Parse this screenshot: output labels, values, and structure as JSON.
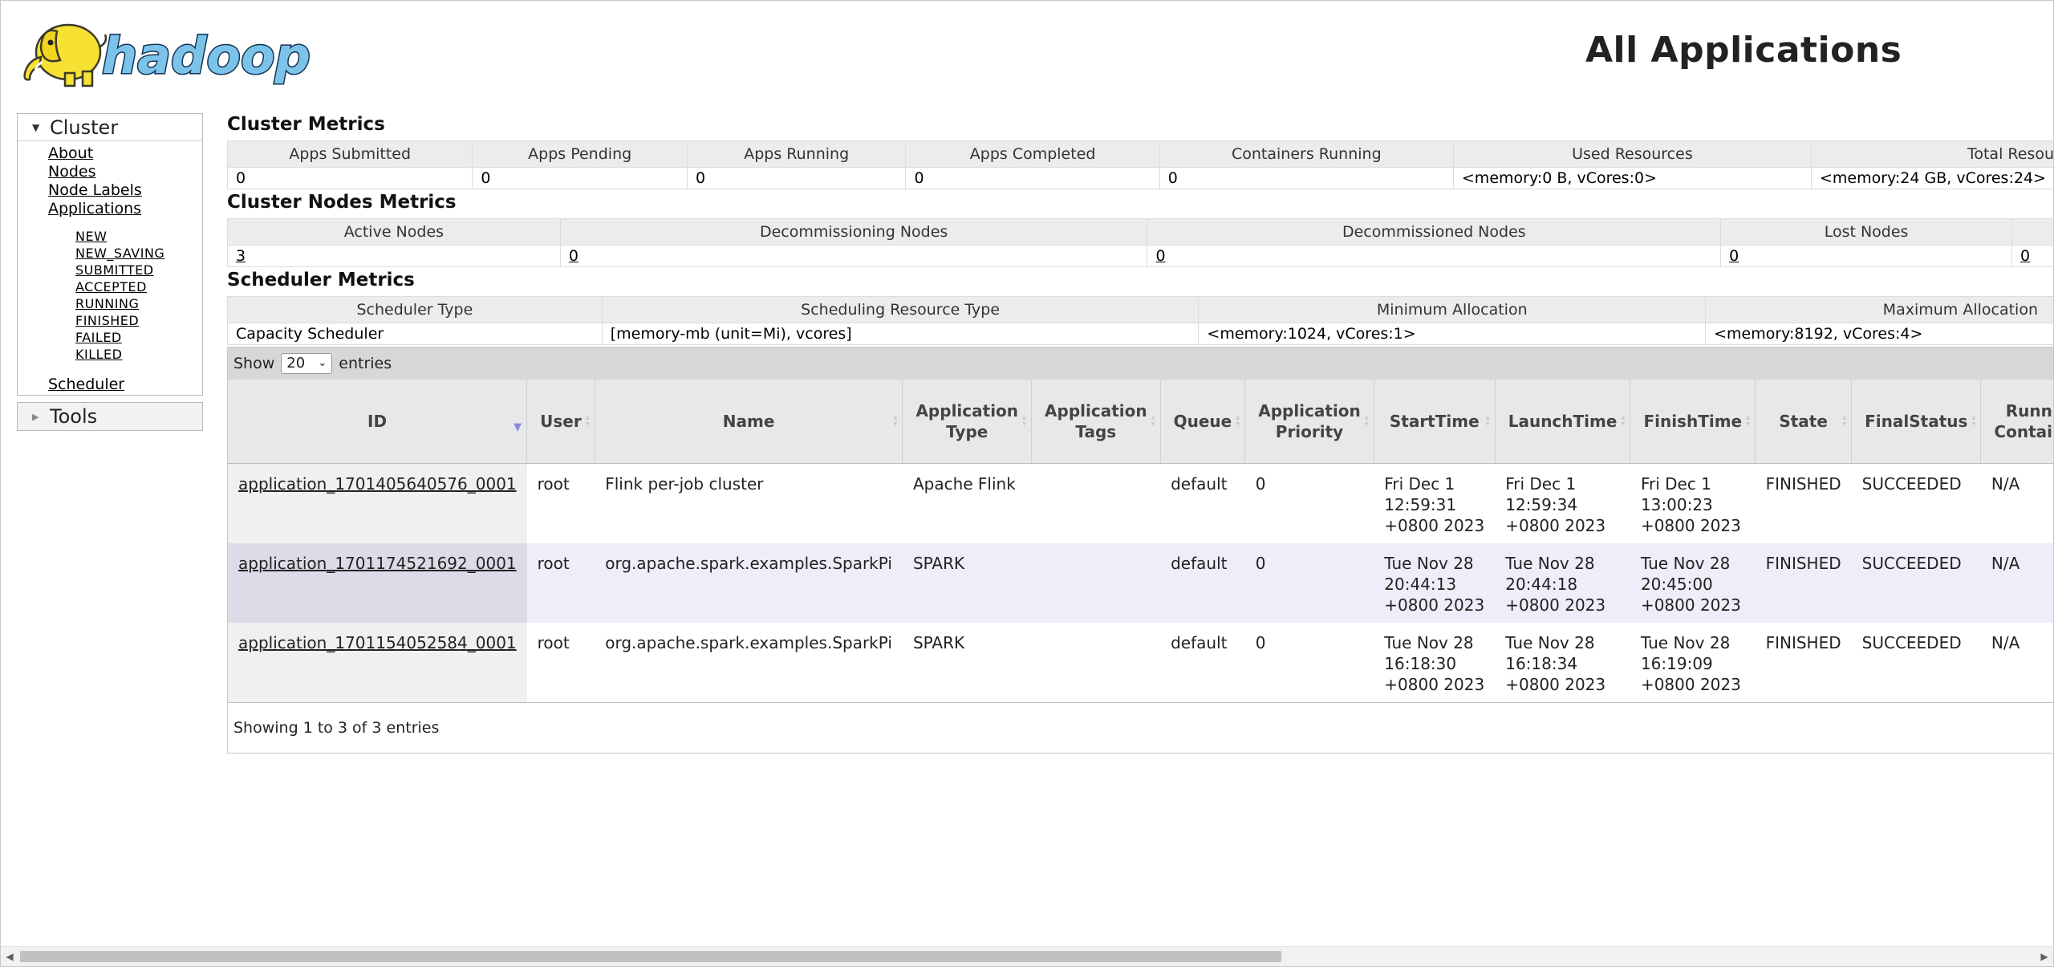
{
  "header": {
    "logo_text": "hadoop",
    "title": "All Applications"
  },
  "sidebar": {
    "cluster": {
      "label": "Cluster",
      "links": [
        "About",
        "Nodes",
        "Node Labels",
        "Applications"
      ],
      "states": [
        "NEW",
        "NEW_SAVING",
        "SUBMITTED",
        "ACCEPTED",
        "RUNNING",
        "FINISHED",
        "FAILED",
        "KILLED"
      ],
      "scheduler": "Scheduler"
    },
    "tools": {
      "label": "Tools"
    }
  },
  "cluster_metrics": {
    "title": "Cluster Metrics",
    "headers": [
      "Apps Submitted",
      "Apps Pending",
      "Apps Running",
      "Apps Completed",
      "Containers Running",
      "Used Resources",
      "Total Resou"
    ],
    "values": [
      "0",
      "0",
      "0",
      "0",
      "0",
      "<memory:0 B, vCores:0>",
      "<memory:24 GB, vCores:24>"
    ]
  },
  "nodes_metrics": {
    "title": "Cluster Nodes Metrics",
    "headers": [
      "Active Nodes",
      "Decommissioning Nodes",
      "Decommissioned Nodes",
      "Lost Nodes",
      ""
    ],
    "values": [
      "3",
      "0",
      "0",
      "0",
      "0"
    ]
  },
  "scheduler_metrics": {
    "title": "Scheduler Metrics",
    "headers": [
      "Scheduler Type",
      "Scheduling Resource Type",
      "Minimum Allocation",
      "Maximum Allocation"
    ],
    "values": [
      "Capacity Scheduler",
      "[memory-mb (unit=Mi), vcores]",
      "<memory:1024, vCores:1>",
      "<memory:8192, vCores:4>"
    ]
  },
  "apps_table": {
    "show_label": "Show",
    "entries_label": "entries",
    "page_size": "20",
    "columns": [
      "ID",
      "User",
      "Name",
      "Application Type",
      "Application Tags",
      "Queue",
      "Application Priority",
      "StartTime",
      "LaunchTime",
      "FinishTime",
      "State",
      "FinalStatus",
      "Running Containers"
    ],
    "rows": [
      {
        "id": "application_1701405640576_0001",
        "user": "root",
        "name": "Flink per-job cluster",
        "type": "Apache Flink",
        "tags": "",
        "queue": "default",
        "priority": "0",
        "start": [
          "Fri Dec 1",
          "12:59:31",
          "+0800 2023"
        ],
        "launch": [
          "Fri Dec 1",
          "12:59:34",
          "+0800 2023"
        ],
        "finish": [
          "Fri Dec 1",
          "13:00:23",
          "+0800 2023"
        ],
        "state": "FINISHED",
        "final_status": "SUCCEEDED",
        "running_containers": "N/A"
      },
      {
        "id": "application_1701174521692_0001",
        "user": "root",
        "name": "org.apache.spark.examples.SparkPi",
        "type": "SPARK",
        "tags": "",
        "queue": "default",
        "priority": "0",
        "start": [
          "Tue Nov 28",
          "20:44:13",
          "+0800 2023"
        ],
        "launch": [
          "Tue Nov 28",
          "20:44:18",
          "+0800 2023"
        ],
        "finish": [
          "Tue Nov 28",
          "20:45:00",
          "+0800 2023"
        ],
        "state": "FINISHED",
        "final_status": "SUCCEEDED",
        "running_containers": "N/A"
      },
      {
        "id": "application_1701154052584_0001",
        "user": "root",
        "name": "org.apache.spark.examples.SparkPi",
        "type": "SPARK",
        "tags": "",
        "queue": "default",
        "priority": "0",
        "start": [
          "Tue Nov 28",
          "16:18:30",
          "+0800 2023"
        ],
        "launch": [
          "Tue Nov 28",
          "16:18:34",
          "+0800 2023"
        ],
        "finish": [
          "Tue Nov 28",
          "16:19:09",
          "+0800 2023"
        ],
        "state": "FINISHED",
        "final_status": "SUCCEEDED",
        "running_containers": "N/A"
      }
    ],
    "footer": "Showing 1 to 3 of 3 entries"
  },
  "icons": {
    "sort_default": "sort-both-icon",
    "sort_active": "sort-asc-icon",
    "expand": "caret-down-icon",
    "collapse": "caret-right-icon"
  },
  "colors": {
    "header_bg": "#ececec",
    "toolbar_bg": "#d7d7d7",
    "even_row_bg": "#eeeefa",
    "sorted_col_bg": "#f0f0f0",
    "sort_active": "#8a8ae0",
    "logo_blue": "#7cc3ea",
    "logo_yellow": "#f7e133"
  }
}
